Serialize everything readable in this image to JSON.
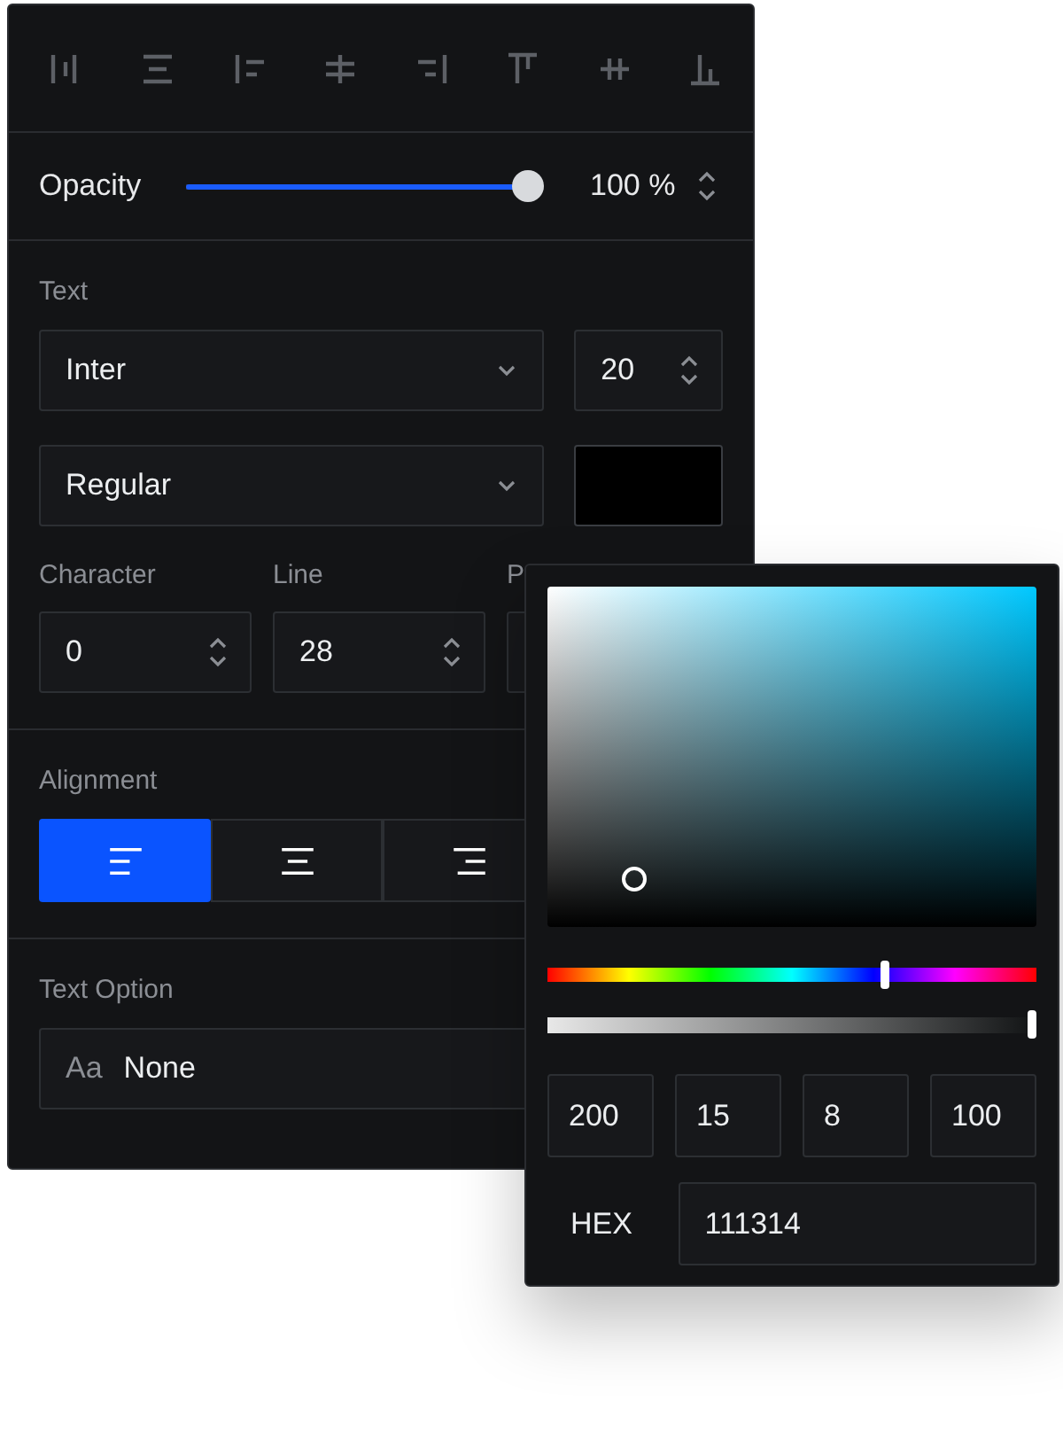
{
  "opacity": {
    "label": "Opacity",
    "level": 1.0,
    "reading": "100 %"
  },
  "text": {
    "label": "Text",
    "font": "Inter",
    "size": "20",
    "weight": "Regular"
  },
  "spacing": [
    {
      "label": "Character",
      "value": "0"
    },
    {
      "label": "Line",
      "value": "28"
    },
    {
      "label": "P"
    }
  ],
  "alignment": {
    "label": "Alignment",
    "options": [
      {
        "kind": "left",
        "selected": true
      },
      {
        "kind": "center",
        "selected": false
      },
      {
        "kind": "right",
        "selected": false
      }
    ]
  },
  "text_option": {
    "label": "Text Option",
    "icon_text": "Aa",
    "value": "None"
  },
  "color_picker": {
    "hue": {
      "level": 0.69
    },
    "alpha": {
      "level": 1.0
    },
    "values": [
      "200",
      "15",
      "8",
      "100"
    ],
    "hex_label": "HEX",
    "hex": "111314"
  }
}
